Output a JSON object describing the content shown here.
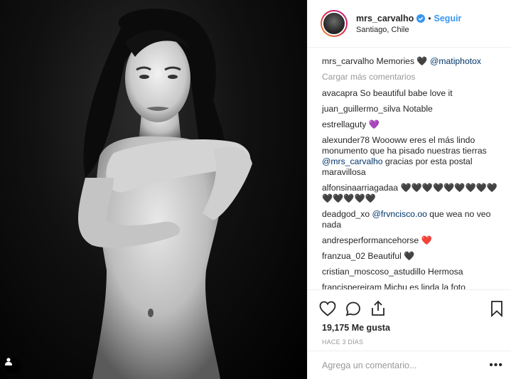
{
  "post": {
    "image_alt": "Black and white portrait photo",
    "user_tag_icon": "person-icon"
  },
  "header": {
    "username": "mrs_carvalho",
    "separator": "•",
    "follow_label": "Seguir",
    "location": "Santiago, Chile",
    "verified_icon": "verified-badge-icon",
    "verified_color": "#3897f0"
  },
  "caption": {
    "username": "mrs_carvalho",
    "text": "Memories 🖤",
    "mention": "@matiphotox"
  },
  "load_more_label": "Cargar más comentarios",
  "comments": [
    {
      "user": "avacapra",
      "text": "So beautiful babe love it",
      "mention": "",
      "after": ""
    },
    {
      "user": "juan_guillermo_silva",
      "text": "Notable",
      "mention": "",
      "after": ""
    },
    {
      "user": "estrellaguty",
      "text": "💜",
      "mention": "",
      "after": ""
    },
    {
      "user": "alexunder78",
      "text": "Woooww eres el más lindo monumento que ha pisado nuestras tierras",
      "mention": "@mrs_carvalho",
      "after": "gracias por esta postal maravillosa"
    },
    {
      "user": "alfonsinaarriagadaa",
      "text": "🖤🖤🖤🖤🖤🖤🖤🖤🖤🖤🖤🖤🖤🖤",
      "mention": "",
      "after": ""
    },
    {
      "user": "deadgod_xo",
      "text": "",
      "mention": "@frvncisco.oo",
      "after": "que wea no veo nada"
    },
    {
      "user": "andresperformancehorse",
      "text": "❤️",
      "mention": "",
      "after": ""
    },
    {
      "user": "franzua_02",
      "text": "Beautiful 🖤",
      "mention": "",
      "after": ""
    },
    {
      "user": "cristian_moscoso_astudillo",
      "text": "Hermosa",
      "mention": "",
      "after": ""
    },
    {
      "user": "francispereiram",
      "text": "Michu es linda la foto",
      "mention": "",
      "after": ""
    }
  ],
  "actions": {
    "like_icon": "heart-outline-icon",
    "comment_icon": "comment-bubble-icon",
    "share_icon": "share-icon",
    "save_icon": "bookmark-icon"
  },
  "likes_count": "19,175",
  "likes_label": "Me gusta",
  "timestamp": "HACE 3 DÍAS",
  "add_comment": {
    "placeholder": "Agrega un comentario...",
    "more_label": "•••"
  }
}
